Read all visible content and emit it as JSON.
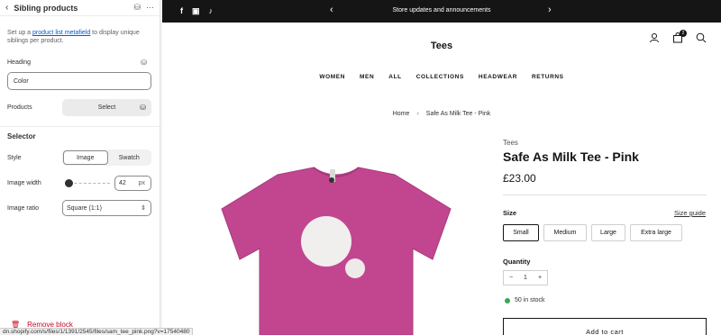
{
  "panel": {
    "title": "Sibling products",
    "back_icon": "chevron-left-icon",
    "help_prefix": "Set up a ",
    "help_link": "product list metafield",
    "help_suffix": " to display unique siblings per product.",
    "heading_label": "Heading",
    "heading_value": "Color",
    "products_label": "Products",
    "products_button": "Select",
    "selector_section": "Selector",
    "style_label": "Style",
    "style_options": [
      "Image",
      "Swatch"
    ],
    "style_selected": "Image",
    "image_width_label": "Image width",
    "image_width_value": "42",
    "image_width_unit": "px",
    "image_width_level": 0.1,
    "image_ratio_label": "Image ratio",
    "image_ratio_value": "Square (1:1)",
    "remove_label": "Remove block"
  },
  "store": {
    "announcement": "Store updates and announcements",
    "logo": "Tees",
    "nav": [
      "WOMEN",
      "MEN",
      "ALL",
      "COLLECTIONS",
      "HEADWEAR",
      "RETURNS"
    ],
    "cart_count": "2",
    "breadcrumb_home": "Home",
    "breadcrumb_current": "Safe As Milk Tee - Pink",
    "vendor": "Tees",
    "product_title": "Safe As Milk Tee - Pink",
    "price": "£23.00",
    "size_label": "Size",
    "size_guide": "Size guide",
    "sizes": [
      "Small",
      "Medium",
      "Large",
      "Extra large"
    ],
    "size_selected": "Small",
    "quantity_label": "Quantity",
    "quantity_value": "1",
    "stock": "50 in stock",
    "add_to_cart": "Add to cart",
    "colors": {
      "shirt": "#c2468f",
      "stock_dot": "#3aa655",
      "topbar": "#151515"
    }
  },
  "status_url": "dn.shopify.com/s/files/1/1391/2545/files/sam_tee_pink.png?v=17540480"
}
